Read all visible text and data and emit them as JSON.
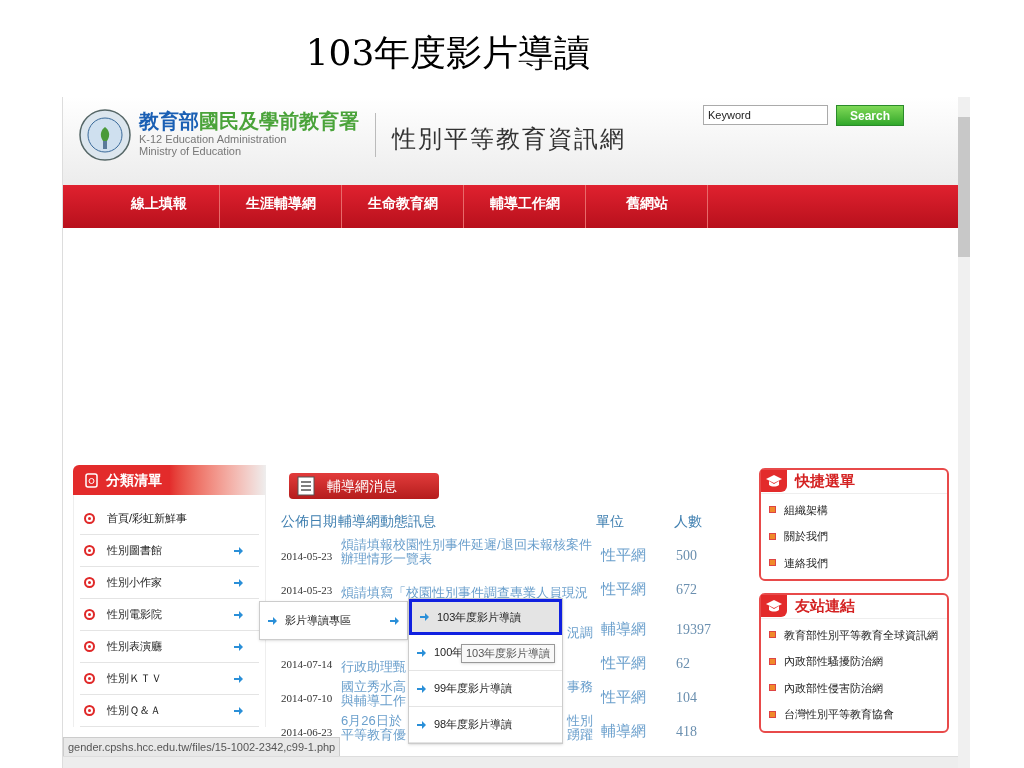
{
  "slide_title": "103年度影片導讀",
  "header": {
    "org_name_part1": "教育部",
    "org_name_part2": "國民及學前教育署",
    "org_en_line1": "K-12 Education Administration",
    "org_en_line2": "Ministry of Education",
    "site_title": "性別平等教育資訊網",
    "search": {
      "placeholder": "Keyword",
      "button": "Search"
    }
  },
  "nav": [
    "線上填報",
    "生涯輔導網",
    "生命教育網",
    "輔導工作網",
    "舊網站"
  ],
  "category_menu": {
    "title": "分類清單",
    "items": [
      {
        "label": "首頁/彩虹新鮮事",
        "has_submenu": false
      },
      {
        "label": "性別圖書館",
        "has_submenu": true
      },
      {
        "label": "性別小作家",
        "has_submenu": true
      },
      {
        "label": "性別電影院",
        "has_submenu": true
      },
      {
        "label": "性別表演廳",
        "has_submenu": true
      },
      {
        "label": "性別ＫＴＶ",
        "has_submenu": true
      },
      {
        "label": "性別Ｑ＆Ａ",
        "has_submenu": true
      }
    ]
  },
  "news": {
    "title": "輔導網消息",
    "columns": [
      "公佈日期",
      "輔導網動態訊息",
      "單位",
      "人數"
    ],
    "rows": [
      {
        "date": "2014-05-23",
        "lines": [
          {
            "left": "煩請填報校園性別事件延遲/退回未報核案件"
          },
          {
            "left": "辦理情形一覽表"
          }
        ],
        "unit": "性平網",
        "count": "500"
      },
      {
        "date": "2014-05-23",
        "lines": [
          {
            "left": "煩請填寫「校園性別事件調查專業人員現況"
          }
        ],
        "unit": "性平網",
        "count": "672"
      },
      {
        "lines": [
          {
            "right": "況調"
          }
        ],
        "unit": "輔導網",
        "count": "19397"
      },
      {
        "date": "2014-07-14",
        "lines": [
          {
            "left": "行政助理甄"
          }
        ],
        "unit": "性平網",
        "count": "62"
      },
      {
        "date": "2014-07-10",
        "lines": [
          {
            "left": "國立秀水高",
            "right": "事務"
          },
          {
            "left": "與輔導工作"
          }
        ],
        "unit": "性平網",
        "count": "104"
      },
      {
        "date": "2014-06-23",
        "lines": [
          {
            "left": "6月26日於",
            "right": "性別"
          },
          {
            "left": "平等教育優",
            "right": "踴躍"
          }
        ],
        "unit": "輔導網",
        "count": "418"
      }
    ]
  },
  "flyout": {
    "label": "影片導讀專區",
    "submenu": [
      {
        "label": "103年度影片導讀",
        "selected": true
      },
      {
        "label": "100年",
        "selected": false
      },
      {
        "label": "99年度影片導讀",
        "selected": false
      },
      {
        "label": "98年度影片導讀",
        "selected": false
      }
    ],
    "tooltip": "103年度影片導讀"
  },
  "quick_menu": {
    "title": "快捷選單",
    "items": [
      "組織架構",
      "關於我們",
      "連絡我們"
    ]
  },
  "friend_links": {
    "title": "友站連結",
    "items": [
      "教育部性別平等教育全球資訊網",
      "內政部性騷擾防治網",
      "內政部性侵害防治網",
      "台灣性別平等教育協會"
    ]
  },
  "status_bar": "gender.cpshs.hcc.edu.tw/files/15-1002-2342,c99-1.php"
}
